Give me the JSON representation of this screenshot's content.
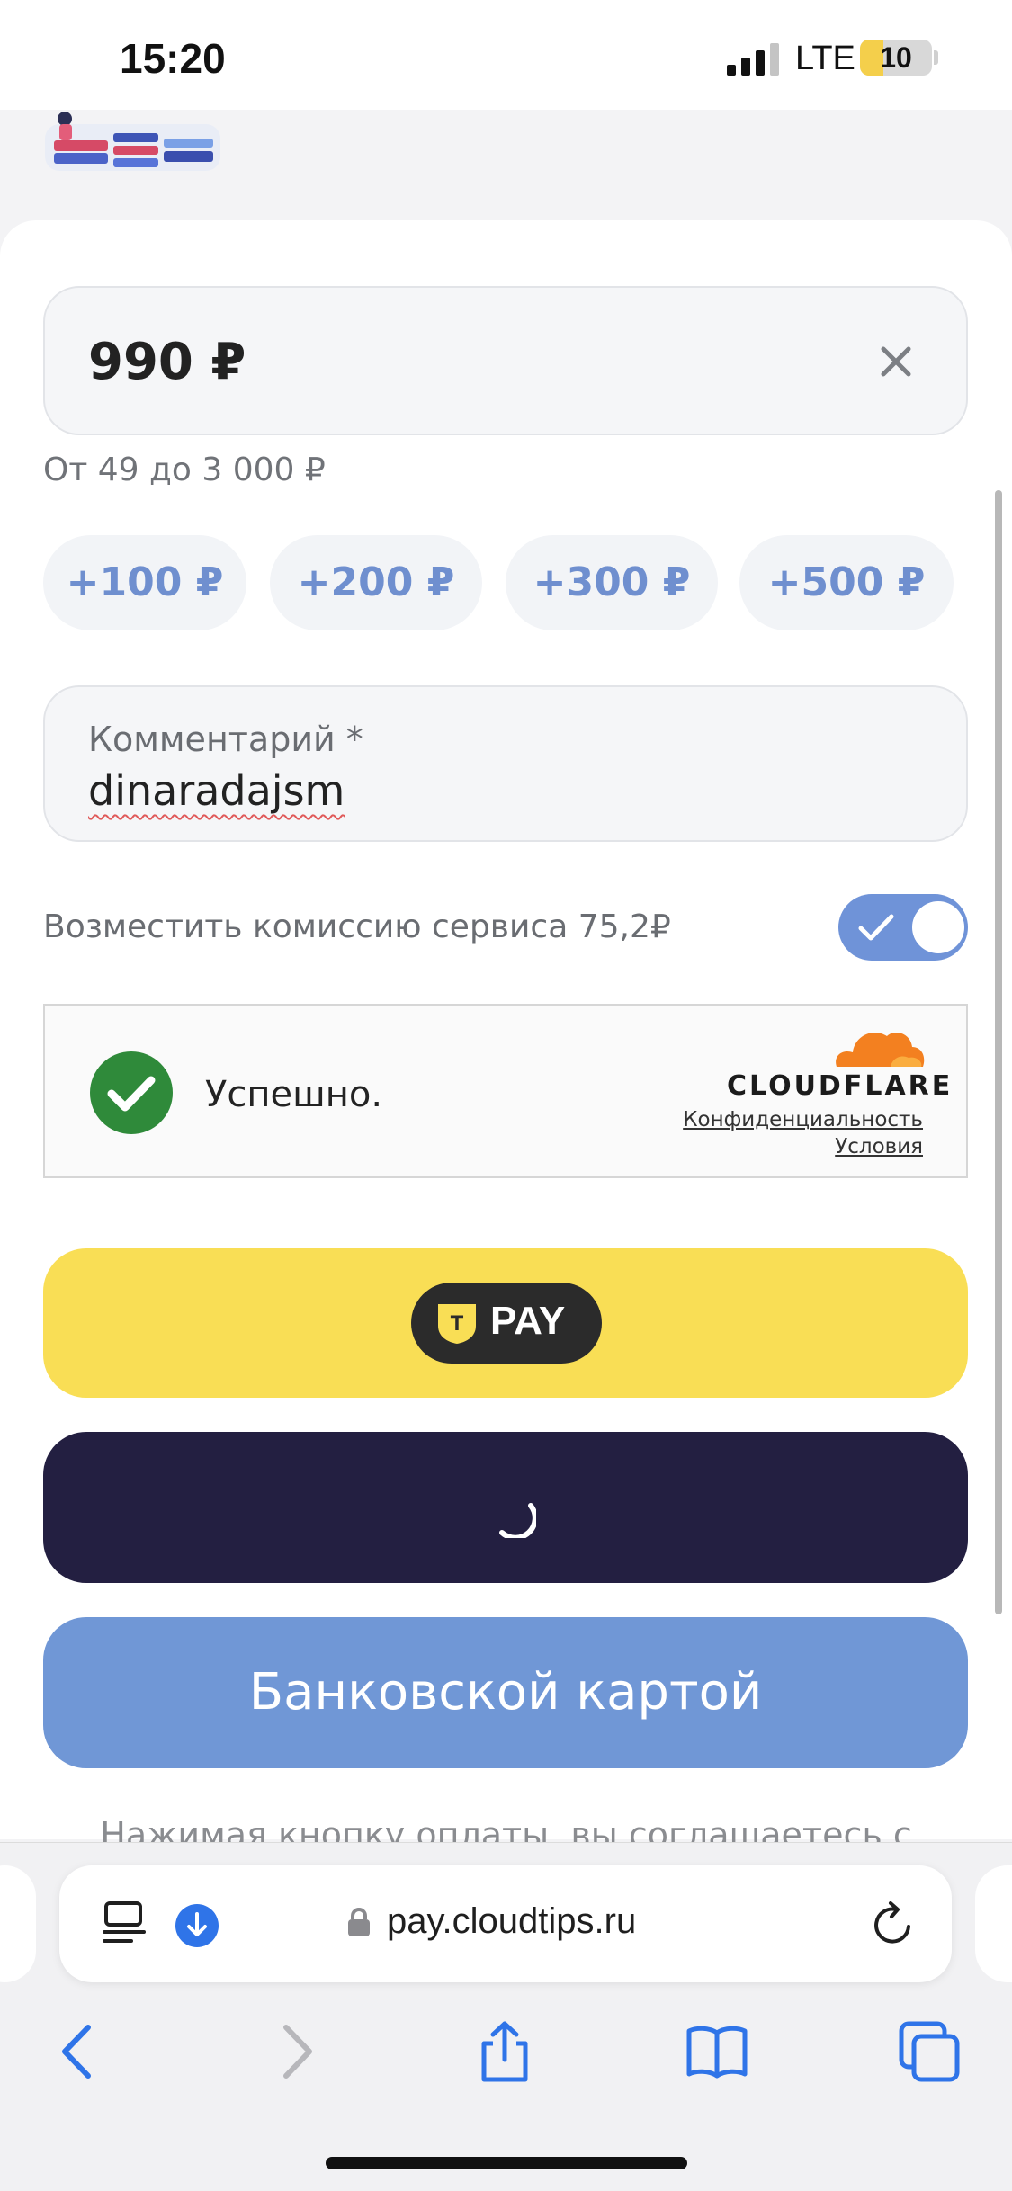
{
  "status_bar": {
    "time": "15:20",
    "network": "LTE",
    "battery": "10",
    "battery_level_percent": 10
  },
  "form": {
    "amount_value": "990 ₽",
    "amount_hint": "От 49 до 3 000 ₽",
    "quick_amounts": [
      "+100 ₽",
      "+200 ₽",
      "+300 ₽",
      "+500 ₽"
    ],
    "comment_label": "Комментарий *",
    "comment_value": "dinaradajsm",
    "fee_label": "Возместить комиссию сервиса 75,2₽",
    "fee_toggle_on": true
  },
  "captcha": {
    "status": "Успешно.",
    "brand": "CLOUDFLARE",
    "privacy_link": "Конфиденциальность",
    "terms_link": "Условия"
  },
  "payments": {
    "tpay_label": "PAY",
    "tpay_logo_letter": "T",
    "card_label": "Банковской картой"
  },
  "terms_text": "Нажимая кнопку оплаты, вы соглашаетесь с",
  "browser": {
    "url": "pay.cloudtips.ru"
  },
  "colors": {
    "accent_blue": "#7097d6",
    "tpay_yellow": "#f9de55",
    "dark_button": "#231f41",
    "success_green": "#2f8a3a",
    "cloudflare_orange": "#f38020"
  },
  "icons": {
    "clear": "close-icon",
    "check": "checkmark-icon",
    "reader": "reader-icon",
    "download": "download-icon",
    "lock": "lock-icon",
    "reload": "reload-icon",
    "back": "chevron-left-icon",
    "forward": "chevron-right-icon",
    "share": "share-icon",
    "bookmarks": "book-icon",
    "tabs": "tabs-icon"
  }
}
